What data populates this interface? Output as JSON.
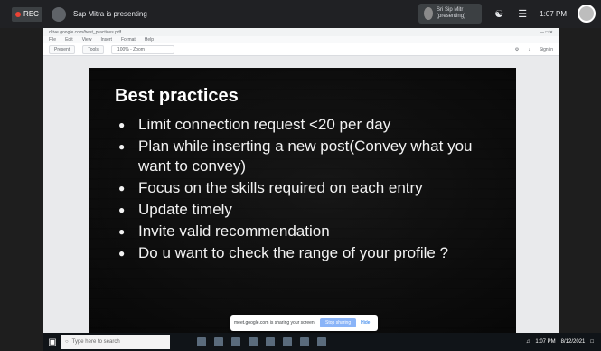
{
  "meet_bar": {
    "rec_label": "REC",
    "presenting_text": "Sap Mitra is presenting",
    "pip_text": "Sri Sip Mitr (presenting)",
    "time": "1:07 PM"
  },
  "browser": {
    "address": "drive.google.com/best_practices.pdf",
    "menu_items": [
      "File",
      "Edit",
      "View",
      "Insert",
      "Format",
      "Help"
    ],
    "toolbar": {
      "btn1": "Present",
      "btn2": "Tools",
      "input_value": "100% - Zoom"
    },
    "sign_in": "Sign in"
  },
  "slide": {
    "title": "Best practices",
    "bullets": [
      "Limit connection request <20 per day",
      "Plan while inserting a new post(Convey what you want to convey)",
      "Focus on the skills required on each entry",
      "Update timely",
      "Invite valid recommendation",
      "Do u want to check the range of your profile ?"
    ]
  },
  "notice": {
    "text": "meet.google.com is sharing your screen.",
    "stop_label": "Stop sharing",
    "hide_label": "Hide"
  },
  "taskbar": {
    "search_placeholder": "Type here to search",
    "time": "1:07 PM",
    "date": "8/12/2021"
  },
  "colors": {
    "meet_bar": "#202124",
    "slide_bg": "#333333",
    "taskbar": "#101418"
  }
}
